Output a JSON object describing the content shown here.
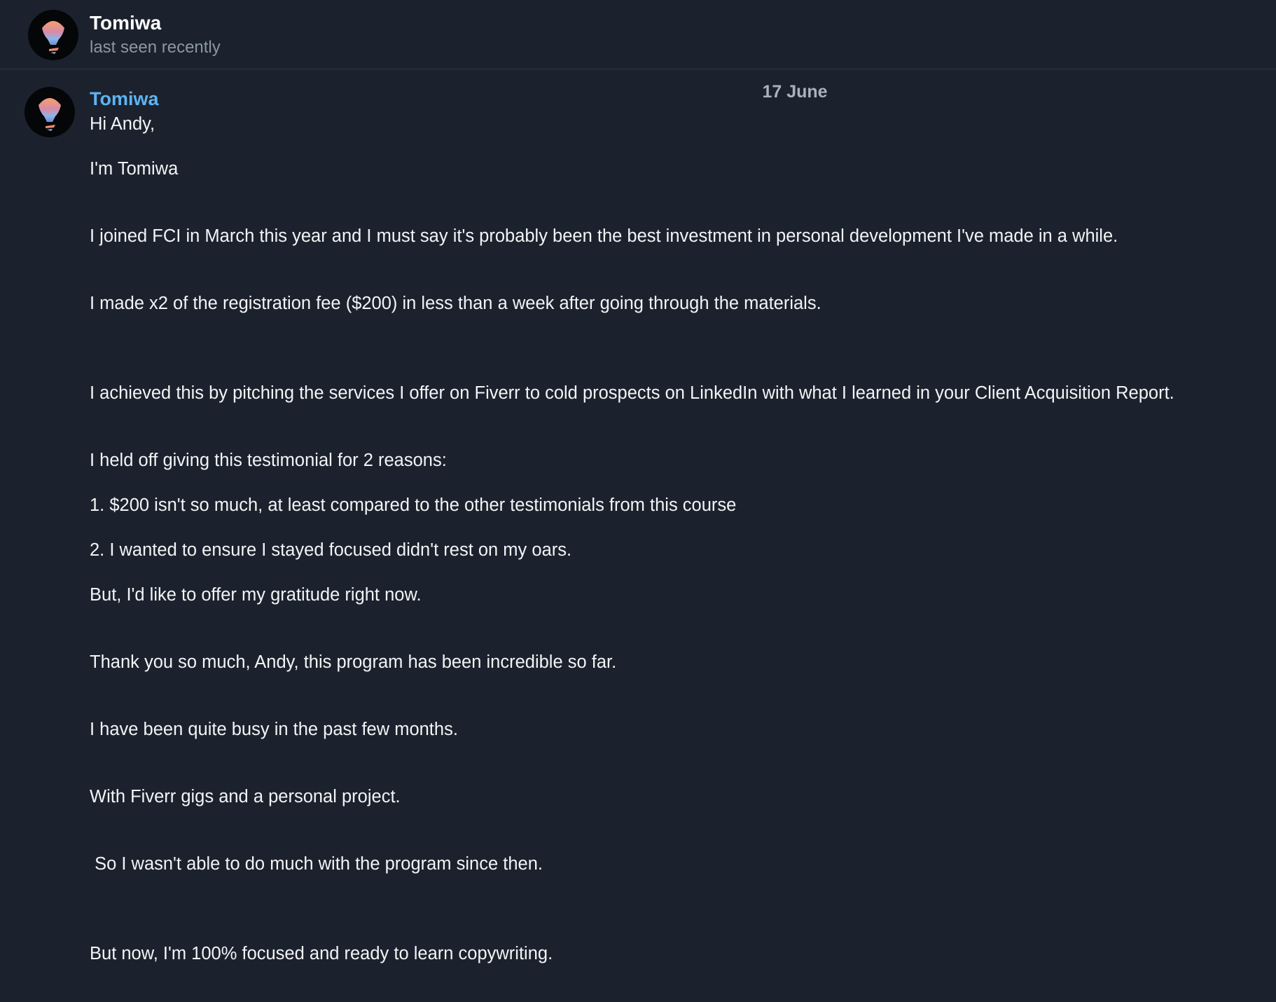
{
  "header": {
    "contact_name": "Tomiwa",
    "status": "last seen recently",
    "avatar_icon": "avatar-icon"
  },
  "date_divider": "17 June",
  "message": {
    "sender": "Tomiwa",
    "lines": [
      "Hi Andy,",
      "I'm Tomiwa",
      "I joined FCI in March this year and I must say it's probably been the best investment in personal development I've made in a while.",
      "I made x2 of the registration fee ($200) in less than a week after going through the materials.",
      "I achieved this by pitching the services I offer on Fiverr to cold prospects on LinkedIn with what I learned in your Client Acquisition Report.",
      "I held off giving this testimonial for 2 reasons:",
      "1. $200 isn't so much, at least compared to the other testimonials from this course",
      "2. I wanted to ensure I stayed focused didn't rest on my oars.",
      "But, I'd like to offer my gratitude right now.",
      "Thank you so much, Andy, this program has been incredible so far.",
      "I have been quite busy in the past few months.",
      "With Fiverr gigs and a personal project.",
      " So I wasn't able to do much with the program since then.",
      "But now, I'm 100% focused and ready to learn copywriting."
    ]
  },
  "colors": {
    "background": "#1b222d",
    "sender_name": "#5eb4f2",
    "muted": "#8b97a6"
  }
}
